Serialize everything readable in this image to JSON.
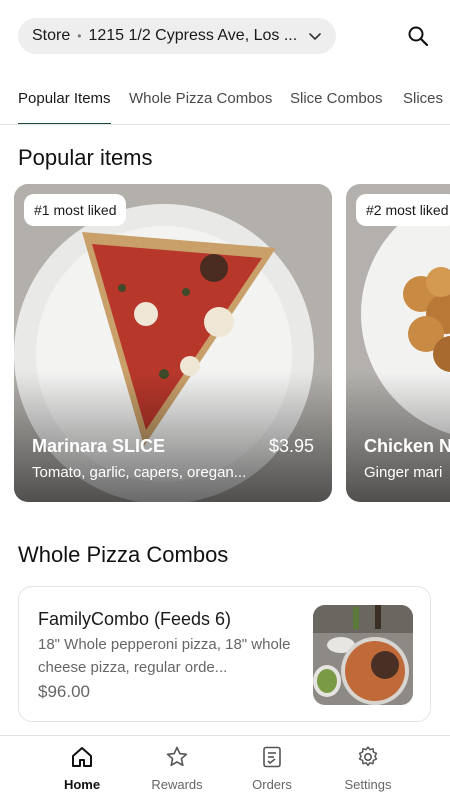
{
  "header": {
    "store_label": "Store",
    "store_address": "1215 1/2 Cypress Ave, Los ...",
    "icons": {
      "dropdown": "chevron-down-icon",
      "search": "search-icon"
    }
  },
  "tabs": [
    {
      "label": "Popular Items",
      "active": true
    },
    {
      "label": "Whole Pizza Combos",
      "active": false
    },
    {
      "label": "Slice Combos",
      "active": false
    },
    {
      "label": "Slices",
      "active": false
    }
  ],
  "popular": {
    "title": "Popular items",
    "items": [
      {
        "badge": "#1 most liked",
        "name": "Marinara SLICE",
        "price": "$3.95",
        "description": "Tomato, garlic, capers, oregan..."
      },
      {
        "badge": "#2 most liked",
        "name": "Chicken N",
        "price": "",
        "description": "Ginger mari"
      }
    ]
  },
  "whole_pizza": {
    "title": "Whole Pizza Combos",
    "items": [
      {
        "name": "FamilyCombo (Feeds 6)",
        "description": "18\" Whole pepperoni pizza, 18\" whole cheese pizza, regular orde...",
        "price": "$96.00"
      }
    ]
  },
  "bottom_nav": [
    {
      "label": "Home",
      "icon": "home-icon",
      "active": true
    },
    {
      "label": "Rewards",
      "icon": "star-icon",
      "active": false
    },
    {
      "label": "Orders",
      "icon": "receipt-icon",
      "active": false
    },
    {
      "label": "Settings",
      "icon": "gear-icon",
      "active": false
    }
  ],
  "colors": {
    "accent": "#1f4d3a",
    "pill_bg": "#eeeeee",
    "divider": "#e3e3e3",
    "muted_text": "#666666"
  }
}
